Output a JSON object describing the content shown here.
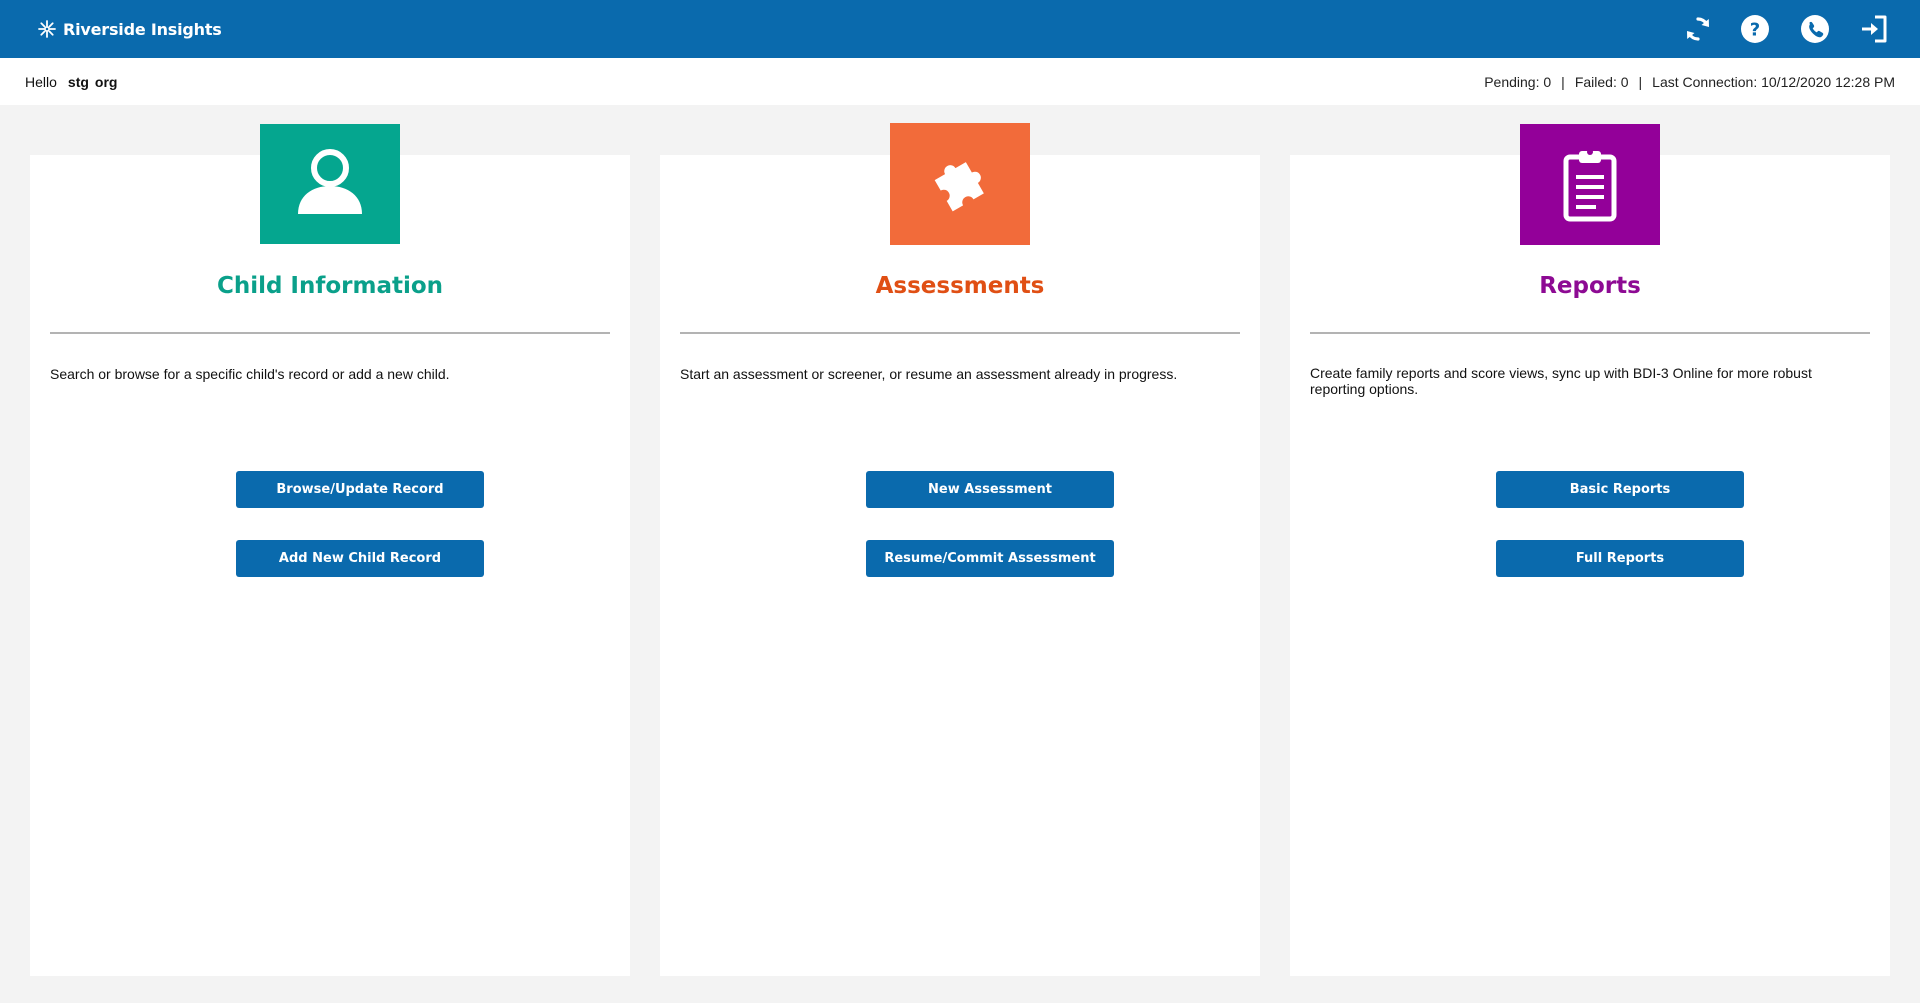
{
  "header": {
    "brand": "Riverside Insights",
    "brand_icon": "asterisk-logo-icon",
    "icons": [
      "sync-icon",
      "help-icon",
      "phone-icon",
      "logout-icon"
    ]
  },
  "infobar": {
    "greeting": "Hello",
    "user_first": "stg",
    "user_last": "org",
    "pending": "Pending: 0",
    "failed": "Failed: 0",
    "last_connection": "Last Connection: 10/12/2020 12:28 PM",
    "separator": "|"
  },
  "cards": [
    {
      "title": "Child Information",
      "accent": "#05a68f",
      "title_color": "#0aa08a",
      "icon": "user-icon",
      "description": "Search or browse for a specific child's record or add a new child.",
      "buttons": [
        "Browse/Update Record",
        "Add New Child Record"
      ]
    },
    {
      "title": "Assessments",
      "accent": "#f26b3a",
      "title_color": "#e04f14",
      "icon": "puzzle-piece-icon",
      "description": "Start an assessment or screener, or resume an assessment already in progress.",
      "buttons": [
        "New Assessment",
        "Resume/Commit Assessment"
      ]
    },
    {
      "title": "Reports",
      "accent": "#930099",
      "title_color": "#8d0a93",
      "icon": "clipboard-icon",
      "description": "Create family reports and score views, sync up with BDI-3 Online for more robust reporting options.",
      "buttons": [
        "Basic Reports",
        "Full Reports"
      ]
    }
  ]
}
